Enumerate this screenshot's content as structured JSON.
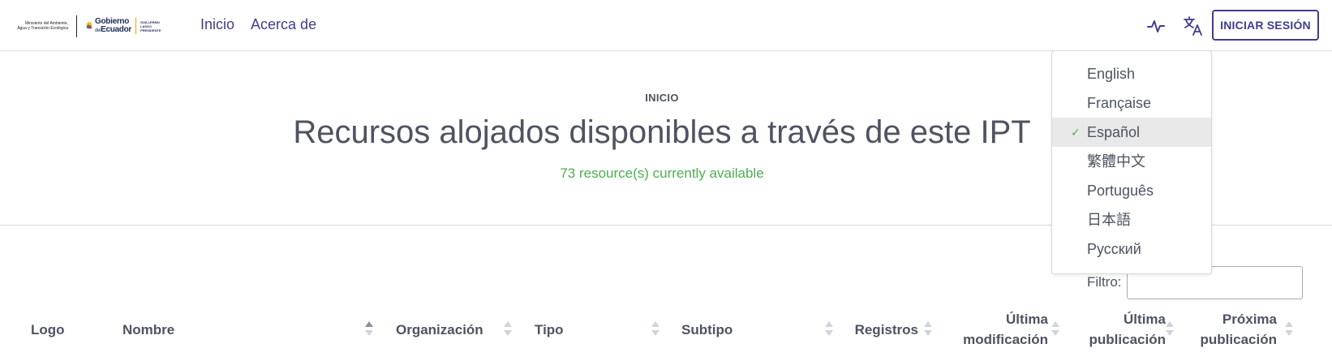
{
  "logo": {
    "ministry_text": "Ministerio del Ambiente, Agua y Transición Ecológica",
    "gov_line1": "Gobierno",
    "gov_line2a": "del",
    "gov_line2b": "Ecuador",
    "gov_sub": "GUILLERMO LASSO PRESIDENTE"
  },
  "nav": {
    "links": [
      "Inicio",
      "Acerca de"
    ],
    "login_label": "INICIAR SESIÓN"
  },
  "header": {
    "breadcrumb": "INICIO",
    "title": "Recursos alojados disponibles a través de este IPT",
    "count": "73 resource(s) currently available"
  },
  "filter": {
    "label": "Filtro:",
    "value": ""
  },
  "table": {
    "columns": [
      {
        "line1": "Logo",
        "line2": ""
      },
      {
        "line1": "Nombre",
        "line2": ""
      },
      {
        "line1": "Organización",
        "line2": ""
      },
      {
        "line1": "Tipo",
        "line2": ""
      },
      {
        "line1": "Subtipo",
        "line2": ""
      },
      {
        "line1": "Registros",
        "line2": ""
      },
      {
        "line1": "Última",
        "line2": "modificación"
      },
      {
        "line1": "Última",
        "line2": "publicación"
      },
      {
        "line1": "Próxima",
        "line2": "publicación"
      }
    ]
  },
  "language_menu": {
    "items": [
      "English",
      "Française",
      "Español",
      "繁體中文",
      "Português",
      "日本語",
      "Русский"
    ],
    "selected": "Español"
  },
  "colors": {
    "brand": "#3f3d8f",
    "text": "#4d5361",
    "success": "#4caf50",
    "selected_bg": "#e9e9ea"
  }
}
